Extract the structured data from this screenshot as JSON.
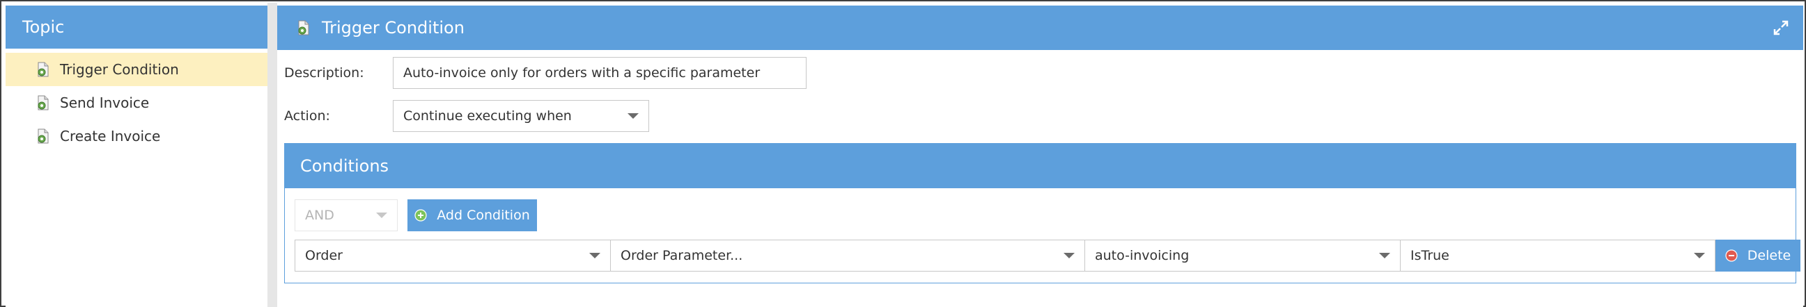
{
  "sidebar": {
    "title": "Topic",
    "items": [
      {
        "label": "Trigger Condition",
        "icon": "document-gear-icon",
        "selected": true
      },
      {
        "label": "Send Invoice",
        "icon": "document-gear-icon",
        "selected": false
      },
      {
        "label": "Create Invoice",
        "icon": "document-gear-icon",
        "selected": false
      }
    ]
  },
  "main": {
    "title": "Trigger Condition",
    "description_label": "Description:",
    "description_value": "Auto-invoice only for orders with a specific parameter",
    "action_label": "Action:",
    "action_value": "Continue executing when"
  },
  "conditions": {
    "title": "Conditions",
    "logic_value": "AND",
    "add_label": "Add Condition",
    "row": {
      "field1": "Order",
      "field2": "Order Parameter...",
      "field3": "auto-invoicing",
      "field4": "IsTrue",
      "delete_label": "Delete"
    }
  },
  "colors": {
    "header": "#5d9fdc",
    "selected": "#fdf0c0"
  }
}
